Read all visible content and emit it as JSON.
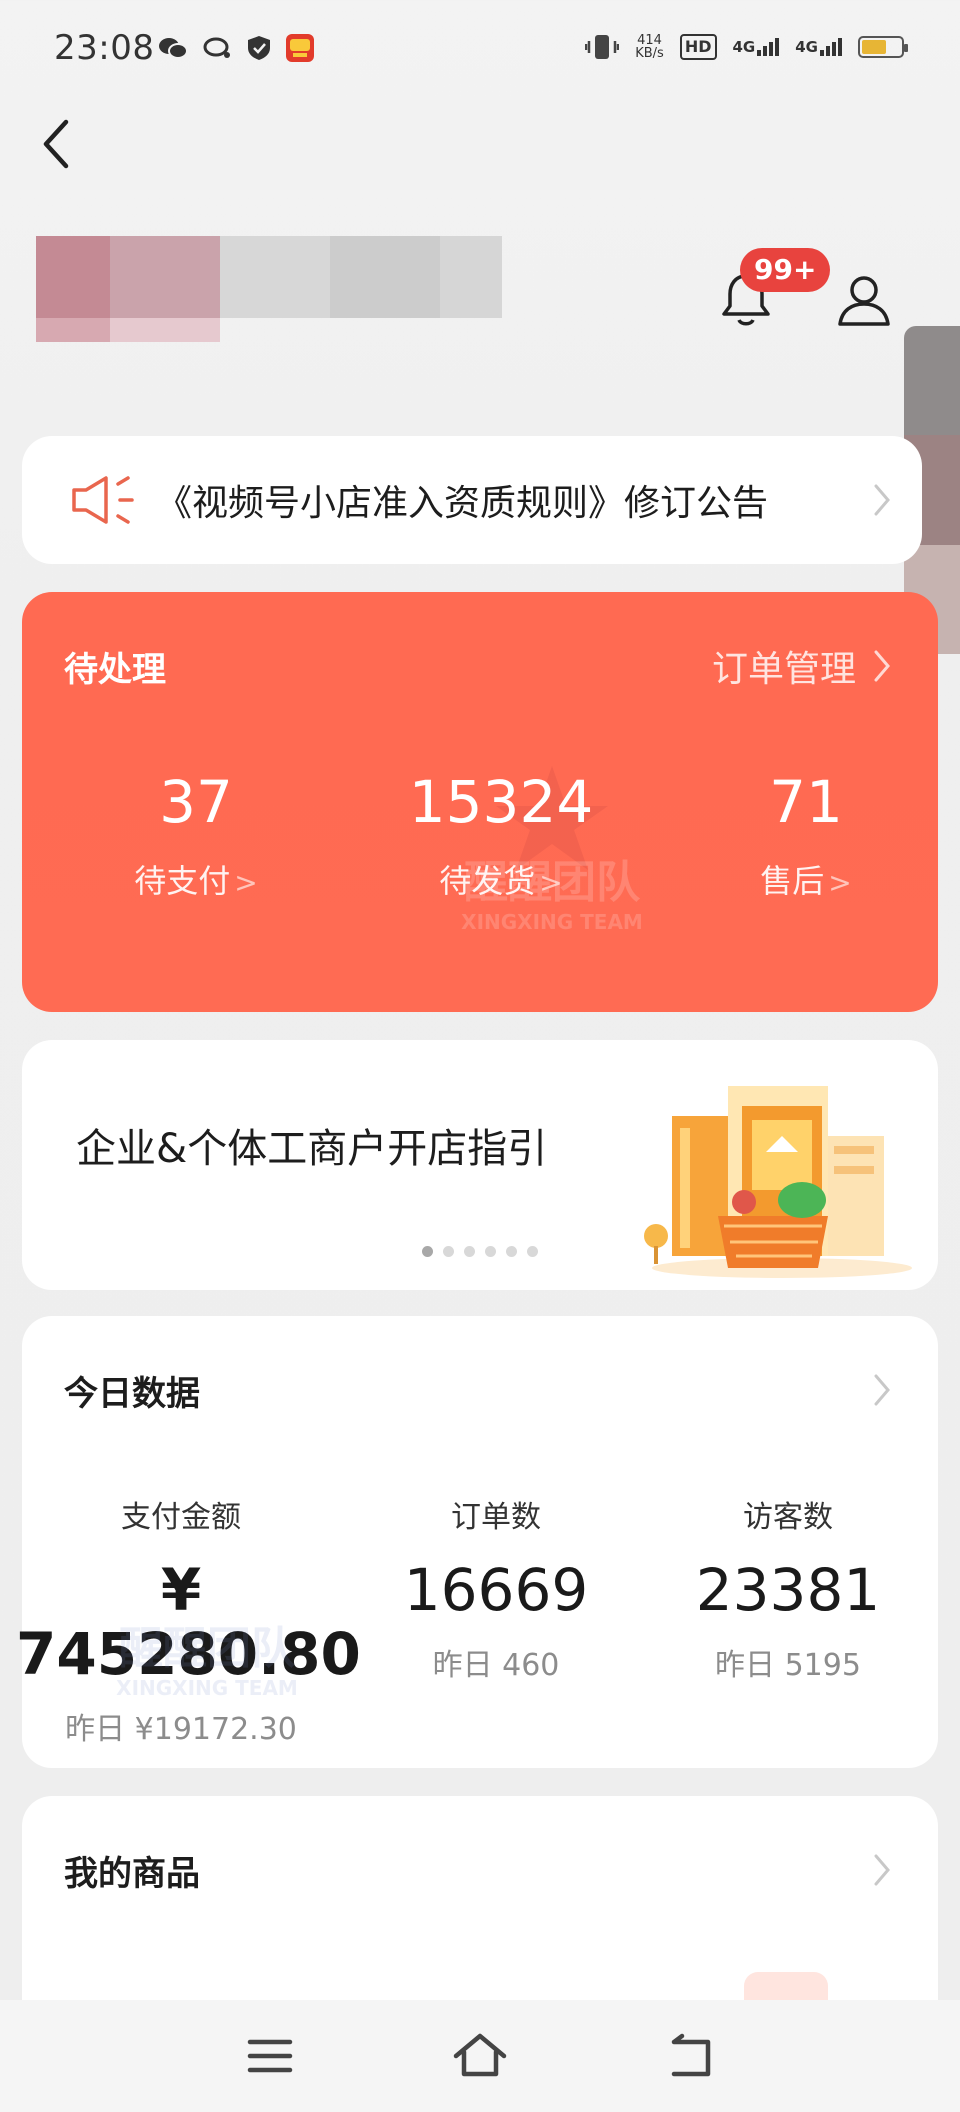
{
  "status": {
    "time": "23:08",
    "speed_value": "414",
    "speed_unit": "KB/s",
    "hd_label": "HD",
    "net1": "4G",
    "net2": "4G"
  },
  "header": {
    "notification_count": "99+"
  },
  "notice": {
    "text": "《视频号小店准入资质规则》修订公告"
  },
  "pending": {
    "title": "待处理",
    "link": "订单管理",
    "stats": [
      {
        "value": "37",
        "label": "待支付"
      },
      {
        "value": "15324",
        "label": "待发货"
      },
      {
        "value": "71",
        "label": "售后"
      }
    ]
  },
  "banner": {
    "text": "企业&个体工商户开店指引",
    "pages": 6,
    "active_page": 1
  },
  "today": {
    "title": "今日数据",
    "stats": [
      {
        "label": "支付金额",
        "value": "¥ 745280.80",
        "sub": "昨日 ¥19172.30"
      },
      {
        "label": "订单数",
        "value": "16669",
        "sub": "昨日 460"
      },
      {
        "label": "访客数",
        "value": "23381",
        "sub": "昨日 5195"
      }
    ]
  },
  "goods": {
    "title": "我的商品"
  },
  "watermark": {
    "cn": "醒醒团队",
    "en": "XINGXING TEAM"
  },
  "colors": {
    "accent": "#ff6a52",
    "badge": "#e8433e",
    "card": "#ffffff",
    "background": "#efefef"
  },
  "icons": [
    "back-icon",
    "bell-icon",
    "user-icon",
    "megaphone-icon",
    "chevron-right-icon",
    "menu-icon",
    "home-icon",
    "return-icon"
  ]
}
